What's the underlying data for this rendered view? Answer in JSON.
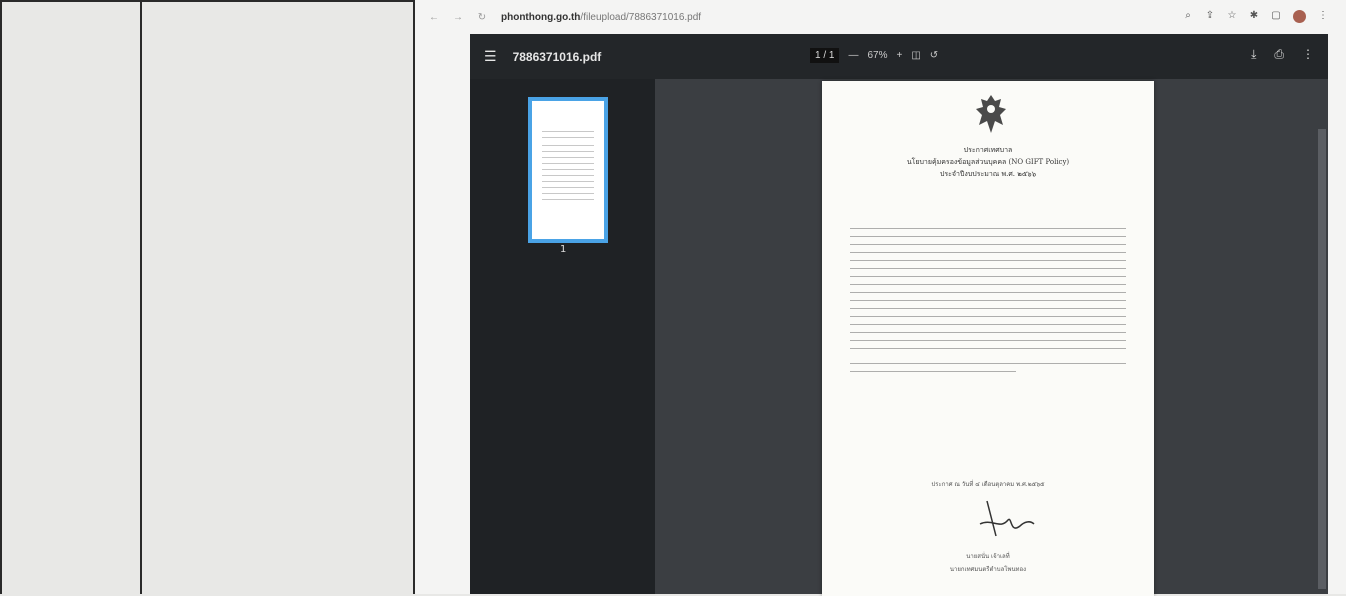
{
  "browser": {
    "back_icon": "arrow-left-icon",
    "forward_icon": "arrow-right-icon",
    "reload_icon": "reload-icon",
    "url_host": "phonthong.go.th",
    "url_path": "/fileupload/7886371016.pdf"
  },
  "viewer": {
    "file_name": "7886371016.pdf",
    "page_indicator": "1 / 1",
    "zoom": "67%",
    "thumbnail_label": "1"
  },
  "document": {
    "title_line_1": "ประกาศเทศบาล",
    "title_line_2": "นโยบายคุ้มครองข้อมูลส่วนบุคคล (NO GIFT Policy)",
    "title_line_3": "ประจำปีงบประมาณ พ.ศ. ๒๕๖๖",
    "date_line": "ประกาศ ณ วันที่ ๔ เดือนตุลาคม พ.ศ.๒๕๖๕",
    "signer_name": "นายสนั่น เจ้าเลที่",
    "signer_position": "นายกเทศมนตรีตำบลโพนทอง"
  }
}
